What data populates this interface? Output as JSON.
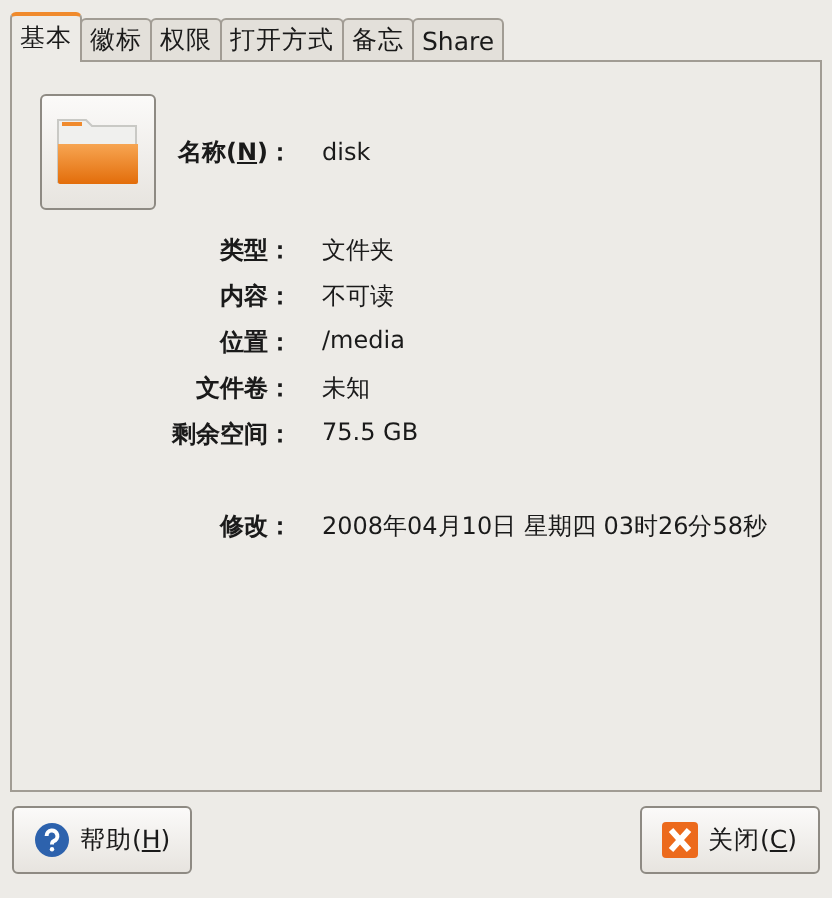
{
  "tabs": [
    {
      "label": "基本",
      "selected": true
    },
    {
      "label": "徽标",
      "selected": false
    },
    {
      "label": "权限",
      "selected": false
    },
    {
      "label": "打开方式",
      "selected": false
    },
    {
      "label": "备忘",
      "selected": false
    },
    {
      "label": "Share",
      "selected": false
    }
  ],
  "name_field": {
    "label_prefix": "名称(",
    "mnemonic": "N",
    "label_suffix": ")：",
    "value": "disk"
  },
  "properties": [
    {
      "label": "类型：",
      "value": "文件夹"
    },
    {
      "label": "内容：",
      "value": "不可读"
    },
    {
      "label": "位置：",
      "value": "/media"
    },
    {
      "label": "文件卷：",
      "value": "未知"
    },
    {
      "label": "剩余空间：",
      "value": "75.5 GB"
    }
  ],
  "modified": {
    "label": "修改：",
    "value": "2008年04月10日 星期四 03时26分58秒"
  },
  "buttons": [
    {
      "kind": "help",
      "prefix": "帮助(",
      "mnemonic": "H",
      "suffix": ")"
    },
    {
      "kind": "close",
      "prefix": "关闭(",
      "mnemonic": "C",
      "suffix": ")"
    }
  ]
}
